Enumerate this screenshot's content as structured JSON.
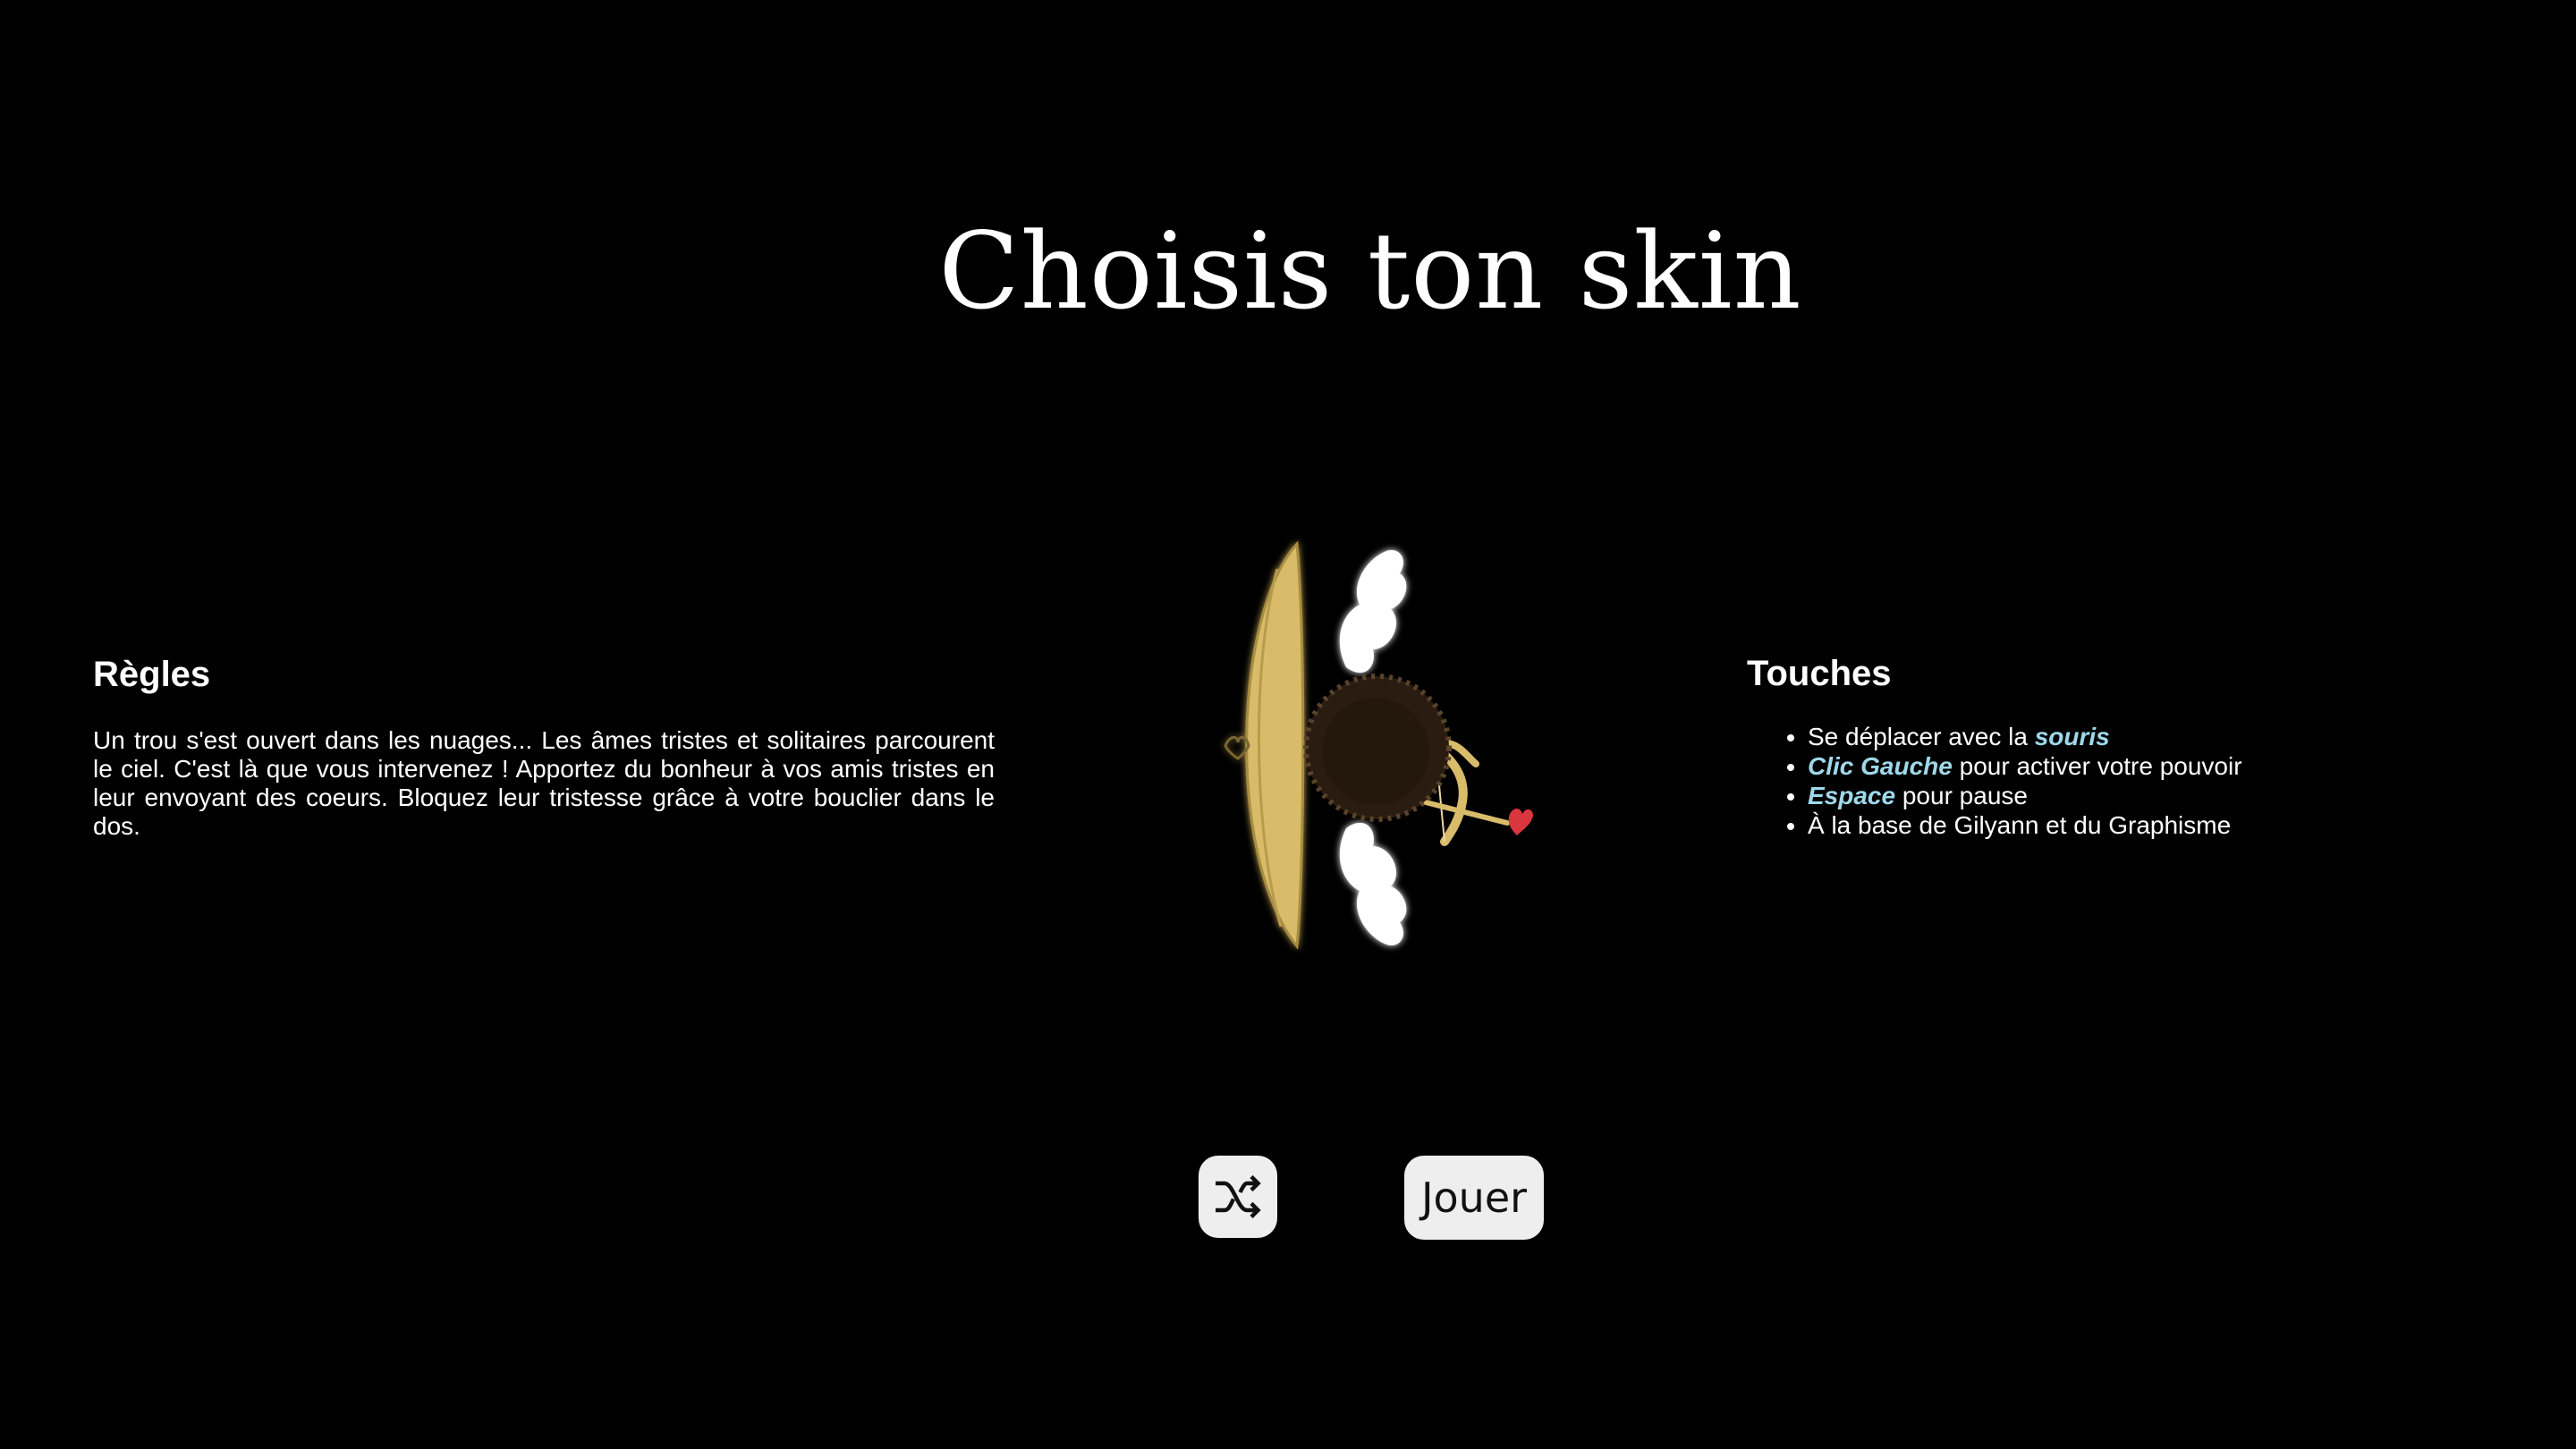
{
  "title": "Choisis ton skin",
  "rules": {
    "heading": "Règles",
    "text": "Un trou s'est ouvert dans les nuages... Les âmes tristes et solitaires parcourent le ciel. C'est là que vous intervenez ! Apportez du bonheur à vos amis tristes en leur envoyant des coeurs. Bloquez leur tristesse grâce à votre bouclier dans le dos."
  },
  "controls": {
    "heading": "Touches",
    "items": [
      {
        "before": "Se déplacer avec la ",
        "key": "souris",
        "after": ""
      },
      {
        "before": "",
        "key": "Clic Gauche",
        "after": " pour activer votre pouvoir"
      },
      {
        "before": "",
        "key": "Espace",
        "after": " pour pause"
      },
      {
        "before": "À la base de Gilyann et du Graphisme",
        "key": "",
        "after": ""
      }
    ]
  },
  "skin_preview": {
    "character": "cupid-character",
    "parts": [
      "golden-shield",
      "angel-wings",
      "dark-hair",
      "bow-with-heart-arrow"
    ]
  },
  "buttons": {
    "shuffle_icon": "shuffle-icon",
    "play_label": "Jouer"
  },
  "colors": {
    "background": "#000000",
    "text": "#ffffff",
    "key_highlight": "#9ed9ea",
    "button_bg": "#eeeeee",
    "shield_gold": "#d9bc6a",
    "hair": "#2a1c10",
    "heart_red": "#d9363e"
  }
}
